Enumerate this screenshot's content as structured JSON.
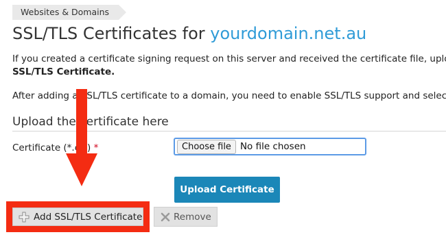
{
  "breadcrumb": {
    "label": "Websites & Domains"
  },
  "header": {
    "title_prefix": "SSL/TLS Certificates for ",
    "domain": "yourdomain.net.au"
  },
  "intro": {
    "line1": "If you created a certificate signing request on this server and received the certificate file, uploac",
    "line1_bold": "SSL/TLS Certificate.",
    "line2": "After adding a SSL/TLS certificate to a domain, you need to enable SSL/TLS support and select"
  },
  "upload_section": {
    "title": "Upload the certificate here",
    "field_label": "Certificate (*.crt)",
    "required_mark": "*",
    "choose_button": "Choose file",
    "file_status": "No file chosen",
    "submit_label": "Upload Certificate"
  },
  "toolbar": {
    "add_label": "Add SSL/TLS Certificate",
    "remove_label": "Remove"
  },
  "colors": {
    "accent_blue": "#2f9bd7",
    "button_blue": "#1b87b8",
    "highlight_red": "#f42c12"
  },
  "icons": {
    "add": "plus-icon",
    "remove": "x-icon",
    "annotation": "down-arrow-icon"
  }
}
